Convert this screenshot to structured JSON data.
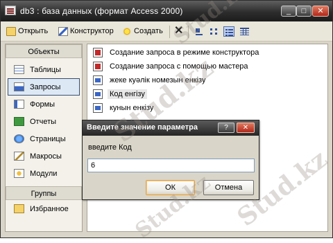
{
  "window": {
    "title": "db3 : база данных (формат Access 2000)"
  },
  "titlebar_buttons": {
    "minimize": "_",
    "maximize": "□",
    "close": "✕"
  },
  "toolbar": {
    "open_label": "Открыть",
    "design_label": "Конструктор",
    "create_label": "Создать",
    "delete_glyph": "✕"
  },
  "sidebar": {
    "objects_header": "Объекты",
    "items": [
      {
        "label": "Таблицы",
        "icon": "table-icon"
      },
      {
        "label": "Запросы",
        "icon": "query-icon",
        "selected": true
      },
      {
        "label": "Формы",
        "icon": "form-icon"
      },
      {
        "label": "Отчеты",
        "icon": "report-icon"
      },
      {
        "label": "Страницы",
        "icon": "page-icon"
      },
      {
        "label": "Макросы",
        "icon": "macro-icon"
      },
      {
        "label": "Модули",
        "icon": "module-icon"
      }
    ],
    "groups_header": "Группы",
    "favorites_label": "Избранное"
  },
  "main": {
    "items": [
      {
        "label": "Создание запроса в режиме конструктора"
      },
      {
        "label": "Создание запроса с помощью мастера"
      },
      {
        "label": "жеке куәлік номезын енкізу"
      },
      {
        "label": "Код енгізу",
        "selected": true
      },
      {
        "label": "кунын енкізу"
      }
    ]
  },
  "dialog": {
    "title": "Введите значение параметра",
    "help_glyph": "?",
    "close_glyph": "✕",
    "prompt": "введите Код",
    "input_value": "6",
    "ok_label": "ОК",
    "cancel_label": "Отмена"
  },
  "watermark": {
    "text": "Stud.kz"
  },
  "colors": {
    "titlebar": "#2d2d2d",
    "selection": "#dde8f5",
    "default_button_border": "#e2a34a",
    "close_button": "#b0271a"
  }
}
